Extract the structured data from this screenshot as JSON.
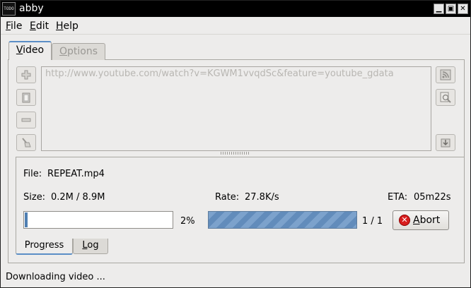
{
  "window": {
    "title": "abby",
    "icon_label": "TODO",
    "min_label": "▁",
    "max_label": "▣",
    "close_label": "✕"
  },
  "menu": {
    "file": {
      "mnemonic": "F",
      "rest": "ile"
    },
    "edit": {
      "mnemonic": "E",
      "rest": "dit"
    },
    "help": {
      "mnemonic": "H",
      "rest": "elp"
    }
  },
  "tabs": {
    "video": {
      "mnemonic": "V",
      "rest": "ideo"
    },
    "options": {
      "mnemonic": "O",
      "rest": "ptions"
    }
  },
  "url_list": {
    "items": [
      "http://www.youtube.com/watch?v=KGWM1vvqdSc&feature=youtube_gdata"
    ]
  },
  "side_icons": {
    "add": "add-icon",
    "paste": "clipboard-icon",
    "remove": "remove-icon",
    "clear": "broom-icon",
    "rss": "rss-icon",
    "search": "search-icon",
    "import": "import-icon"
  },
  "progress": {
    "file_label": "File:",
    "file_name": "REPEAT.mp4",
    "size_label": "Size:",
    "size_value": "0.2M / 8.9M",
    "rate_label": "Rate:",
    "rate_value": "27.8K/s",
    "eta_label": "ETA:",
    "eta_value": "05m22s",
    "file_percent": 2,
    "file_percent_text": "2%",
    "queue_fraction": 1.0,
    "queue_text": "1 / 1",
    "abort": {
      "mnemonic": "A",
      "rest": "bort"
    }
  },
  "bottom_tabs": {
    "progress": {
      "before": "Pro",
      "mnemonic": "g",
      "rest": "ress"
    },
    "log": {
      "mnemonic": "L",
      "rest": "og"
    }
  },
  "status": "Downloading video ...",
  "colors": {
    "accent": "#5b8ec6",
    "progress_fill": "#4f7fb2",
    "abort_red": "#d81e1e"
  }
}
